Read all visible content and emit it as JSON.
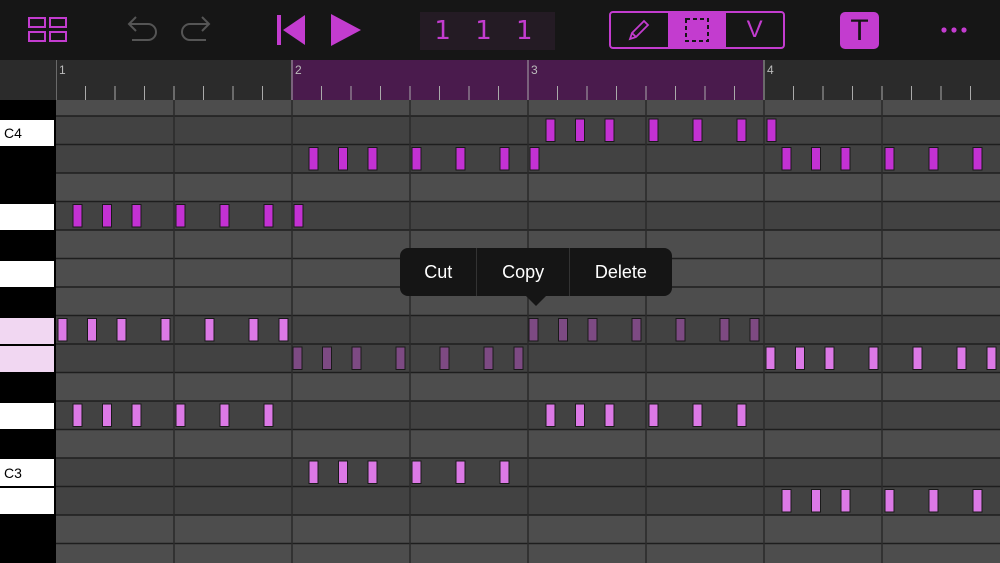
{
  "toolbar": {
    "position": "1 1 1",
    "velocity_mode_label": "V",
    "track_button_label": "T"
  },
  "ruler": {
    "bars": [
      "1",
      "2",
      "3",
      "4"
    ]
  },
  "piano": {
    "labels": {
      "c4": "C4",
      "c3": "C3"
    }
  },
  "popup": {
    "cut": "Cut",
    "copy": "Copy",
    "delete": "Delete"
  },
  "colors": {
    "accent": "#c33ccf",
    "note": "#c331d3",
    "note_light": "#dc79e6",
    "note_dim": "#7d4a83",
    "selection": "#4a1b4d"
  }
}
